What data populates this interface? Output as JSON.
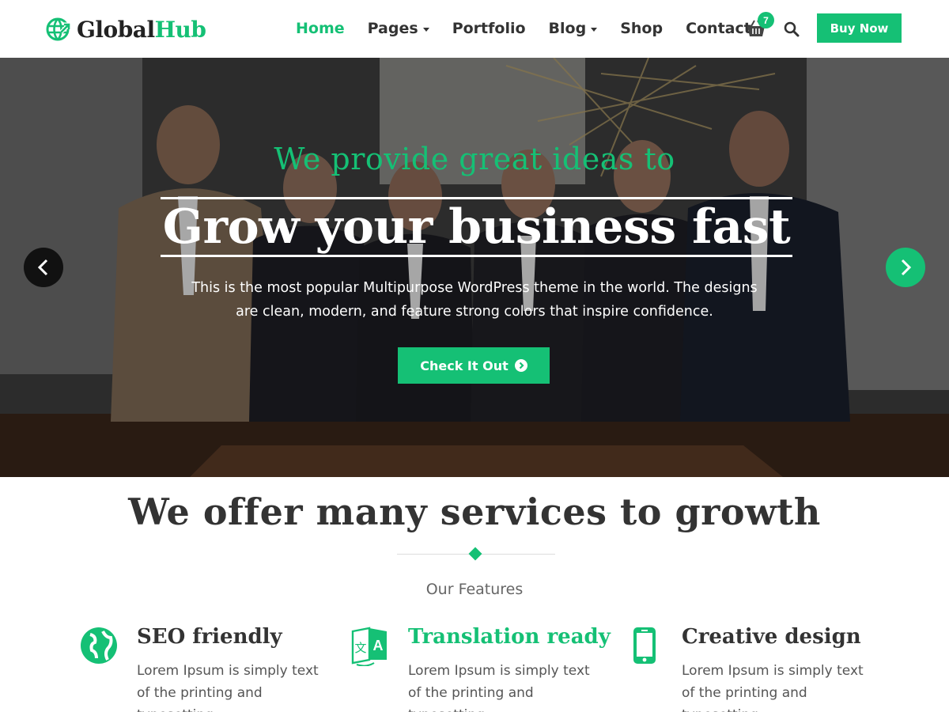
{
  "brand": {
    "name_part1": "Global",
    "name_part2": "Hub",
    "accent_color": "#15c075"
  },
  "nav": {
    "items": [
      {
        "label": "Home",
        "active": true,
        "has_dropdown": false
      },
      {
        "label": "Pages",
        "active": false,
        "has_dropdown": true
      },
      {
        "label": "Portfolio",
        "active": false,
        "has_dropdown": false
      },
      {
        "label": "Blog",
        "active": false,
        "has_dropdown": true
      },
      {
        "label": "Shop",
        "active": false,
        "has_dropdown": false
      },
      {
        "label": "Contact",
        "active": false,
        "has_dropdown": false
      }
    ],
    "cart_icon": "basket-icon",
    "cart_count": "7",
    "search_icon": "search-icon",
    "buy_label": "Buy Now"
  },
  "hero": {
    "kicker": "We provide great ideas to",
    "title": "Grow your business fast",
    "description": "This is the most popular Multipurpose WordPress theme in the world. The designs are clean, modern, and feature strong colors that inspire confidence.",
    "cta_label": "Check It Out",
    "cta_icon": "chevron-circle-right-icon",
    "prev_icon": "chevron-left-icon",
    "next_icon": "chevron-right-icon"
  },
  "services": {
    "title": "We offer many services to growth",
    "subtitle": "Our Features",
    "features": [
      {
        "icon": "globe-icon",
        "title": "SEO friendly",
        "text": "Lorem Ipsum is simply text of the printing and typesetting"
      },
      {
        "icon": "translate-icon",
        "title": "Translation ready",
        "text": "Lorem Ipsum is simply text of the printing and typesetting"
      },
      {
        "icon": "mobile-icon",
        "title": "Creative design",
        "text": "Lorem Ipsum is simply text of the printing and typesetting"
      }
    ]
  }
}
